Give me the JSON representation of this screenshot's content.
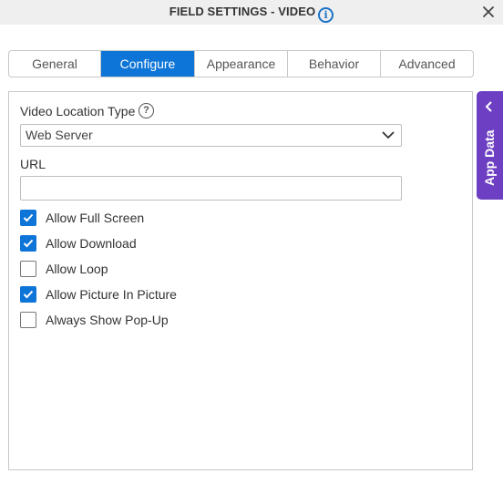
{
  "header": {
    "title": "FIELD SETTINGS - VIDEO",
    "info_icon": "info-icon",
    "close_icon": "close-icon"
  },
  "tabs": [
    {
      "label": "General",
      "active": false
    },
    {
      "label": "Configure",
      "active": true
    },
    {
      "label": "Appearance",
      "active": false
    },
    {
      "label": "Behavior",
      "active": false
    },
    {
      "label": "Advanced",
      "active": false
    }
  ],
  "form": {
    "video_location_type": {
      "label": "Video Location Type",
      "help_icon": "help-icon",
      "selected": "Web Server"
    },
    "url": {
      "label": "URL",
      "value": "",
      "placeholder": ""
    },
    "checkboxes": [
      {
        "label": "Allow Full Screen",
        "checked": true
      },
      {
        "label": "Allow Download",
        "checked": true
      },
      {
        "label": "Allow Loop",
        "checked": false
      },
      {
        "label": "Allow Picture In Picture",
        "checked": true
      },
      {
        "label": "Always Show Pop-Up",
        "checked": false
      }
    ]
  },
  "side_panel": {
    "label": "App Data",
    "icon": "chevron-left-icon"
  },
  "colors": {
    "accent": "#0d74d8",
    "side_panel": "#6d3fc2",
    "title_bar": "#efefef"
  }
}
